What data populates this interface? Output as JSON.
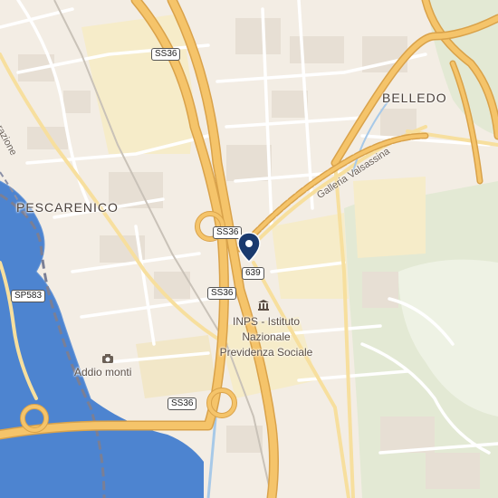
{
  "map": {
    "areas": {
      "pescarenico": "PESCARENICO",
      "belledo": "BELLEDO"
    },
    "streets": {
      "liberazione": "Liberazione",
      "galleria_valsassina": "Galleria Valsassina"
    },
    "shields": {
      "ss36_top": "SS36",
      "ss36_mid": "SS36",
      "ss36_lower": "SS36",
      "ss36_bottom": "SS36",
      "r639": "639",
      "sp583": "SP583"
    },
    "pois": {
      "addio_monti": "Addio monti",
      "inps_line1": "INPS - Istituto",
      "inps_line2": "Nazionale",
      "inps_line3": "Previdenza Sociale"
    },
    "marker": {
      "icon": "location-pin-icon",
      "color": "#1a3a6e"
    },
    "colors": {
      "background": "#f3ede4",
      "water": "#4d84d0",
      "highway": "#f5c46a",
      "highway_casing": "#d9a24a",
      "minor_road": "#ffffff",
      "green": "#dfe8cf",
      "industrial": "#f7efd2"
    }
  }
}
